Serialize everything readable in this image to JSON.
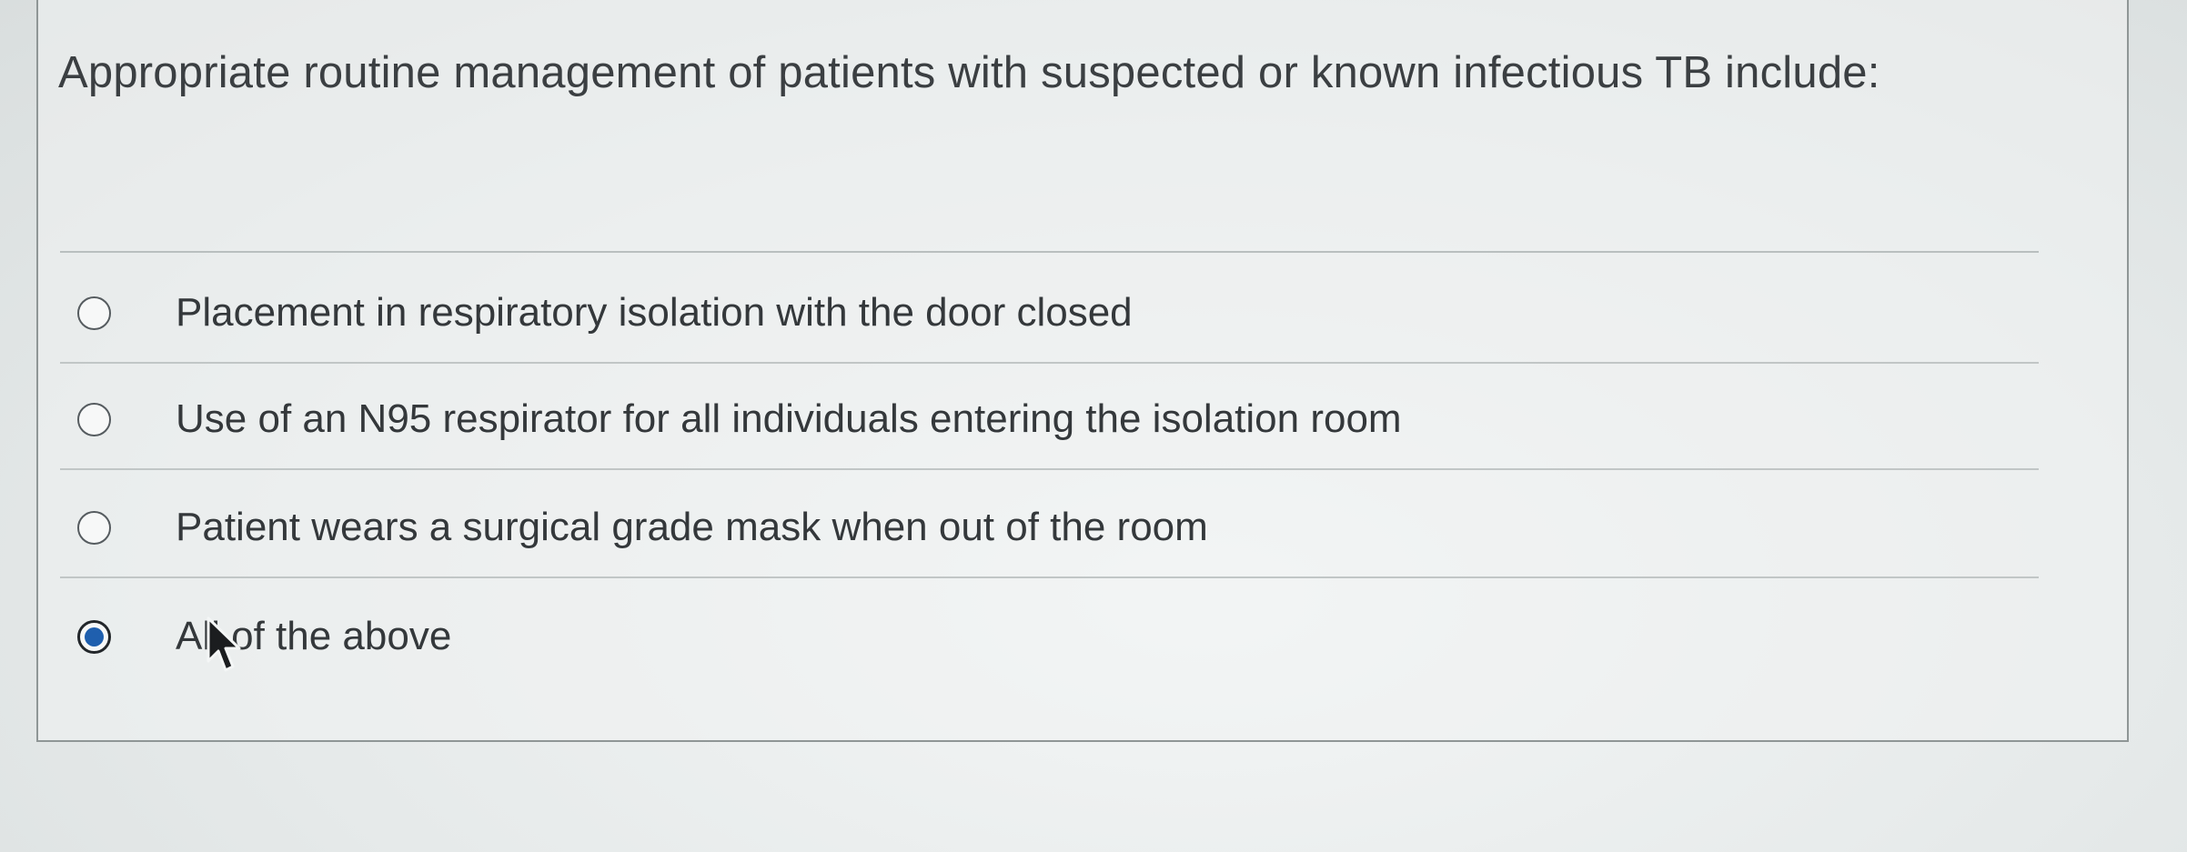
{
  "question": {
    "text": "Appropriate routine management of patients with suspected or known infectious TB include:"
  },
  "answers": [
    {
      "label": "Placement in respiratory isolation with the door closed",
      "selected": false
    },
    {
      "label": "Use of an N95 respirator for all individuals entering the isolation room",
      "selected": false
    },
    {
      "label": "Patient wears a surgical grade mask when out of the room",
      "selected": false
    },
    {
      "label": "All of the above",
      "selected": true
    }
  ],
  "colors": {
    "selected_radio": "#1f5fae",
    "text": "#34383b",
    "panel_border": "#8f9696"
  },
  "icons": {
    "cursor": "mouse-pointer-icon"
  }
}
